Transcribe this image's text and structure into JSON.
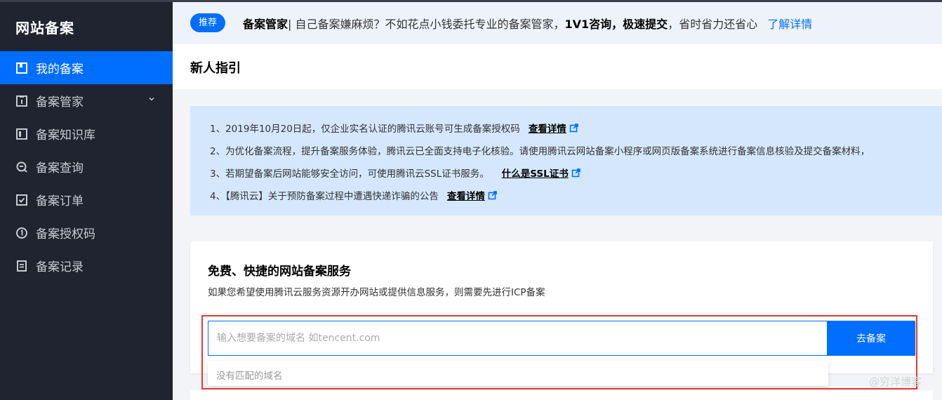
{
  "sidebar": {
    "brand": "网站备案",
    "items": [
      {
        "label": "我的备案",
        "icon": "bookmark-icon",
        "active": true
      },
      {
        "label": "备案管家",
        "icon": "id-card-icon",
        "expandable": true
      },
      {
        "label": "备案知识库",
        "icon": "book-icon"
      },
      {
        "label": "备案查询",
        "icon": "search-icon"
      },
      {
        "label": "备案订单",
        "icon": "checklist-icon"
      },
      {
        "label": "备案授权码",
        "icon": "number-one-icon"
      },
      {
        "label": "备案记录",
        "icon": "document-icon"
      }
    ]
  },
  "banner": {
    "badge": "推荐",
    "strong_title": "备案管家",
    "text_1": "| 自己备案嫌麻烦？不如花点小钱委托专业的备案管家，",
    "strong_1": "1V1咨询",
    "sep": "，",
    "strong_2": "极速提交",
    "text_2": "，省时省力还省心",
    "link": "了解详情"
  },
  "guide": {
    "title": "新人指引",
    "notices": [
      {
        "text": "1、2019年10月20日起，仅企业实名认证的腾讯云账号可生成备案授权码",
        "link": "查看详情"
      },
      {
        "text": "2、为优化备案流程，提升备案服务体验，腾讯云已全面支持电子化核验。请使用腾讯云网站备案小程序或网页版备案系统进行备案信息核验及提交备案材料，",
        "link": ""
      },
      {
        "text": "3、若期望备案后网站能够安全访问，可使用腾讯云SSL证书服务。",
        "link": "什么是SSL证书"
      },
      {
        "text": "4、【腾讯云】关于预防备案过程中遭遇快递诈骗的公告",
        "link": "查看详情"
      }
    ]
  },
  "service": {
    "title": "免费、快捷的网站备案服务",
    "subtitle": "如果您希望使用腾讯云服务资源开办网站或提供信息服务，则需要先进行ICP备案",
    "search_value": "",
    "search_placeholder": "输入想要备案的域名 如tencent.com",
    "button": "去备案",
    "dropdown_empty": "没有匹配的域名"
  },
  "watermark": "@穷洋博客",
  "colors": {
    "accent": "#006eff",
    "sidebar_bg": "#202431",
    "notice_bg": "#d5e7fd",
    "highlight": "#e53935"
  }
}
